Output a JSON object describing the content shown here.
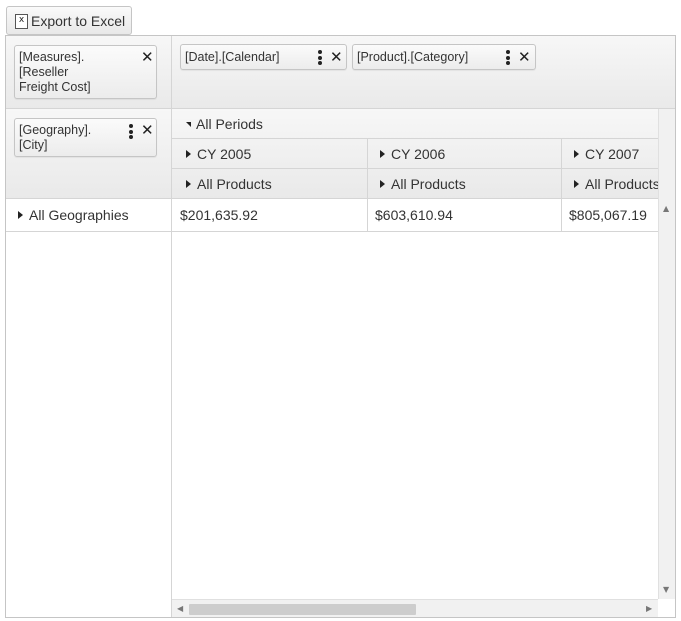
{
  "toolbar": {
    "export_label": "Export to Excel",
    "export_icon": "excel-icon",
    "export_icon_glyph": "x"
  },
  "measures_zone": {
    "field": {
      "label_lines": [
        "[Measures].",
        "[Reseller",
        "Freight Cost]"
      ]
    }
  },
  "column_zone": {
    "fields": [
      {
        "label": "[Date].[Calendar]"
      },
      {
        "label": "[Product].[Category]"
      }
    ]
  },
  "row_zone": {
    "fields": [
      {
        "label_lines": [
          "[Geography].",
          "[City]"
        ]
      }
    ]
  },
  "column_headers": {
    "level1": "All Periods",
    "years": [
      "CY 2005",
      "CY 2006",
      "CY 2007"
    ],
    "products": [
      "All Products",
      "All Products",
      "All Products"
    ]
  },
  "row_headers": {
    "rows": [
      "All Geographies"
    ]
  },
  "data_cells": [
    [
      "$201,635.92",
      "$603,610.94",
      "$805,067.19"
    ]
  ],
  "icons": {
    "close": "close-icon",
    "menu": "kebab-menu-icon",
    "expand": "expand-arrow-icon",
    "collapse": "collapse-arrow-icon"
  },
  "colors": {
    "border": "#c5c5c5",
    "header_gradient_top": "#f7f7f7",
    "header_gradient_bottom": "#e9e9e9",
    "scrollbar_thumb": "#cdcdcd"
  }
}
